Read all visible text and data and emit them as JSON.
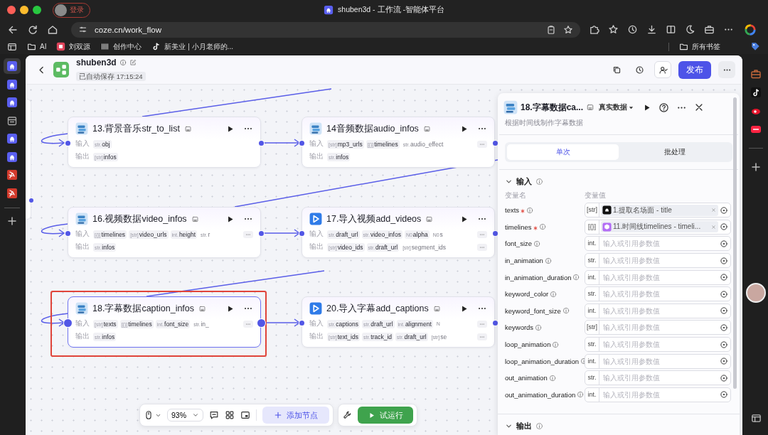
{
  "browser": {
    "login": "登录",
    "title": "shuben3d - 工作流 -智能体平台",
    "url": "coze.cn/work_flow",
    "bookmarks": [
      {
        "label": "AI",
        "kind": "folder"
      },
      {
        "label": "刘双源",
        "kind": "app"
      },
      {
        "label": "创作中心",
        "kind": "bars"
      },
      {
        "label": "新美业 | 小月老师的...",
        "kind": "note"
      }
    ],
    "all_bookmarks": "所有书签"
  },
  "side_tabs": [
    {
      "kind": "bot",
      "selected": true
    },
    {
      "kind": "bot",
      "selected": false
    },
    {
      "kind": "bot",
      "selected": false
    },
    {
      "kind": "calendar",
      "selected": false
    },
    {
      "kind": "bot",
      "selected": false
    },
    {
      "kind": "bot",
      "selected": false
    },
    {
      "kind": "runner",
      "selected": false
    },
    {
      "kind": "runner",
      "selected": false
    }
  ],
  "app": {
    "name": "shuben3d",
    "autosave": "已自动保存 17:15:24",
    "publish": "发布"
  },
  "nodes": [
    {
      "title": "13.背景音乐str_to_list",
      "kind": "plugin",
      "selected": false,
      "highlighted": false,
      "inputs_label": "输入",
      "outputs_label": "输出",
      "inputs": [
        {
          "type": "str.",
          "name": "obj"
        }
      ],
      "outputs": [
        {
          "type": "[str]",
          "name": "infos"
        }
      ],
      "inputs_more": false,
      "outputs_more": false
    },
    {
      "title": "14音频数据audio_infos",
      "kind": "plugin",
      "selected": false,
      "highlighted": false,
      "inputs_label": "输入",
      "outputs_label": "输出",
      "inputs": [
        {
          "type": "[str]",
          "name": "mp3_urls"
        },
        {
          "type": "[{}]",
          "name": "timelines"
        },
        {
          "type": "str.",
          "name": "audio_effect",
          "faded": true
        }
      ],
      "outputs": [
        {
          "type": "str.",
          "name": "infos"
        }
      ],
      "inputs_more": true,
      "outputs_more": false
    },
    {
      "title": "16.视频数据video_infos",
      "kind": "plugin",
      "selected": false,
      "highlighted": false,
      "inputs_label": "输入",
      "outputs_label": "输出",
      "inputs": [
        {
          "type": "[{}]",
          "name": "timelines"
        },
        {
          "type": "[str]",
          "name": "video_urls"
        },
        {
          "type": "int.",
          "name": "height"
        },
        {
          "type": "str.",
          "name": "r",
          "faded": true
        }
      ],
      "outputs": [
        {
          "type": "str.",
          "name": "infos"
        }
      ],
      "inputs_more": true,
      "outputs_more": false
    },
    {
      "title": "17.导入视频add_videos",
      "kind": "play",
      "selected": false,
      "highlighted": false,
      "inputs_label": "输入",
      "outputs_label": "输出",
      "inputs": [
        {
          "type": "str.",
          "name": "draft_url"
        },
        {
          "type": "str.",
          "name": "video_infos"
        },
        {
          "type": "N0",
          "name": "alpha"
        },
        {
          "type": "N0",
          "name": "s",
          "faded": true
        }
      ],
      "outputs": [
        {
          "type": "[str]",
          "name": "video_ids"
        },
        {
          "type": "str.",
          "name": "draft_url"
        },
        {
          "type": "[str]",
          "name": "segment_ids",
          "faded": true
        }
      ],
      "inputs_more": true,
      "outputs_more": true
    },
    {
      "title": "18.字幕数据caption_infos",
      "kind": "plugin",
      "selected": true,
      "highlighted": true,
      "inputs_label": "输入",
      "outputs_label": "输出",
      "inputs": [
        {
          "type": "[str]",
          "name": "texts"
        },
        {
          "type": "[{}]",
          "name": "timelines"
        },
        {
          "type": "int.",
          "name": "font_size"
        },
        {
          "type": "str.",
          "name": "in_",
          "faded": true
        }
      ],
      "outputs": [
        {
          "type": "str.",
          "name": "infos"
        }
      ],
      "inputs_more": true,
      "outputs_more": false
    },
    {
      "title": "20.导入字幕add_captions",
      "kind": "play",
      "selected": false,
      "highlighted": false,
      "inputs_label": "输入",
      "outputs_label": "输出",
      "inputs": [
        {
          "type": "str.",
          "name": "captions"
        },
        {
          "type": "str.",
          "name": "draft_url"
        },
        {
          "type": "int.",
          "name": "alignment"
        },
        {
          "type": "N",
          "faded": true
        }
      ],
      "outputs": [
        {
          "type": "[str]",
          "name": "text_ids"
        },
        {
          "type": "str.",
          "name": "track_id"
        },
        {
          "type": "str.",
          "name": "draft_url"
        },
        {
          "type": "[str]",
          "name": "se",
          "faded": true
        }
      ],
      "inputs_more": true,
      "outputs_more": true
    }
  ],
  "panel": {
    "title": "18.字幕数据ca...",
    "mode": "真实数据",
    "description": "根据时间线制作字幕数据",
    "tabs": [
      {
        "label": "单次",
        "selected": true
      },
      {
        "label": "批处理",
        "selected": false
      }
    ],
    "input_section": {
      "title": "输入",
      "expanded": true
    },
    "col_name": "变量名",
    "col_value": "变量值",
    "params": [
      {
        "name": "texts",
        "required": true,
        "type": "[str]",
        "ref": {
          "kind": "bot",
          "text": "1.提取名场面 - title"
        }
      },
      {
        "name": "timelines",
        "required": true,
        "type": "[{}]",
        "ref": {
          "kind": "cube",
          "text": "11.时间线timelines - timeli..."
        }
      },
      {
        "name": "font_size",
        "required": false,
        "type": "int.",
        "placeholder": "输入或引用参数值"
      },
      {
        "name": "in_animation",
        "required": false,
        "type": "str.",
        "placeholder": "输入或引用参数值"
      },
      {
        "name": "in_animation_duration",
        "required": false,
        "type": "int.",
        "placeholder": "输入或引用参数值"
      },
      {
        "name": "keyword_color",
        "required": false,
        "type": "str.",
        "placeholder": "输入或引用参数值"
      },
      {
        "name": "keyword_font_size",
        "required": false,
        "type": "int.",
        "placeholder": "输入或引用参数值"
      },
      {
        "name": "keywords",
        "required": false,
        "type": "[str]",
        "placeholder": "输入或引用参数值"
      },
      {
        "name": "loop_animation",
        "required": false,
        "type": "str.",
        "placeholder": "输入或引用参数值"
      },
      {
        "name": "loop_animation_duration",
        "required": false,
        "type": "int.",
        "placeholder": "输入或引用参数值"
      },
      {
        "name": "out_animation",
        "required": false,
        "type": "str.",
        "placeholder": "输入或引用参数值"
      },
      {
        "name": "out_animation_duration",
        "required": false,
        "type": "int.",
        "placeholder": "输入或引用参数值"
      }
    ],
    "output_section": {
      "title": "输出",
      "expanded": true
    }
  },
  "toolbar": {
    "zoom": "93%",
    "add_node": "添加节点",
    "test_run": "试运行"
  }
}
